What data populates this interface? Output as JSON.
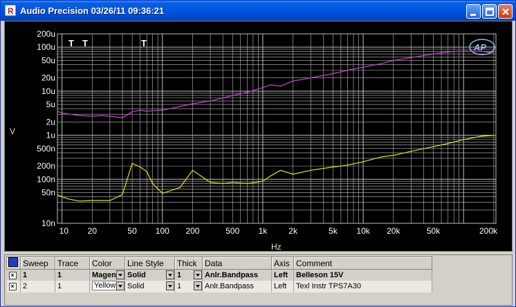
{
  "window": {
    "title": "Audio Precision  03/26/11 09:36:21",
    "app_icon": "R"
  },
  "colors": {
    "trace1": "#d040e0",
    "trace2": "#e8e800",
    "grid": "#c0c0c0",
    "titlebar": "#0054e3"
  },
  "plot": {
    "logo": "AP",
    "ylabel": "V",
    "xlabel": "Hz",
    "markers": [
      "T",
      "T",
      "T"
    ],
    "y_ticks": [
      "200u",
      "100u",
      "50u",
      "20u",
      "10u",
      "5u",
      "2u",
      "1u",
      "500n",
      "200n",
      "100n",
      "50n",
      "10n"
    ],
    "x_ticks": [
      "10",
      "20",
      "50",
      "100",
      "200",
      "500",
      "1k",
      "2k",
      "5k",
      "10k",
      "20k",
      "50k",
      "200k"
    ]
  },
  "chart_data": {
    "type": "line",
    "x_scale": "log",
    "y_scale": "log",
    "xlim": [
      9,
      210000
    ],
    "ylim": [
      1e-08,
      0.0002
    ],
    "xlabel": "Hz",
    "ylabel": "V",
    "series": [
      {
        "color": "#d040e0",
        "x": [
          9,
          10,
          12,
          15,
          20,
          25,
          30,
          40,
          50,
          60,
          70,
          80,
          100,
          150,
          200,
          300,
          400,
          500,
          700,
          1000,
          1200,
          1500,
          2000,
          3000,
          5000,
          7000,
          10000,
          15000,
          20000,
          30000,
          50000,
          70000,
          100000,
          150000,
          200000
        ],
        "y": [
          3.5e-06,
          3.2e-06,
          3e-06,
          2.8e-06,
          2.7e-06,
          2.8e-06,
          2.7e-06,
          2.5e-06,
          3.4e-06,
          3.7e-06,
          3.5e-06,
          3.6e-06,
          3.7e-06,
          4.5e-06,
          5.2e-06,
          6e-06,
          7e-06,
          8e-06,
          9.5e-06,
          1.2e-05,
          1.4e-05,
          1.3e-05,
          1.7e-05,
          2e-05,
          2.5e-05,
          3e-05,
          3.5e-05,
          4.2e-05,
          5e-05,
          5.8e-05,
          7e-05,
          7.8e-05,
          8.2e-05,
          8e-05,
          7.5e-05
        ]
      },
      {
        "color": "#e8e800",
        "x": [
          9,
          10,
          12,
          15,
          20,
          25,
          30,
          40,
          50,
          60,
          70,
          80,
          100,
          150,
          200,
          300,
          400,
          500,
          700,
          1000,
          1200,
          1500,
          2000,
          3000,
          5000,
          7000,
          10000,
          15000,
          20000,
          30000,
          50000,
          70000,
          100000,
          150000,
          200000
        ],
        "y": [
          4.5e-08,
          4e-08,
          3.5e-08,
          3.2e-08,
          3.3e-08,
          3.3e-08,
          3.3e-08,
          4.5e-08,
          2.3e-07,
          1.9e-07,
          1.5e-07,
          8e-08,
          4.8e-08,
          6.5e-08,
          1.6e-07,
          8.5e-08,
          8e-08,
          8.5e-08,
          8e-08,
          9e-08,
          1.2e-07,
          1.6e-07,
          1.3e-07,
          1.6e-07,
          1.9e-07,
          2.1e-07,
          2.5e-07,
          3.2e-07,
          3.5e-07,
          4.3e-07,
          5.5e-07,
          6.5e-07,
          8e-07,
          9.5e-07,
          1e-06
        ]
      }
    ]
  },
  "table": {
    "headers": [
      "Sweep",
      "Trace",
      "Color",
      "Line Style",
      "Thick",
      "Data",
      "Axis",
      "Comment"
    ],
    "rows": [
      {
        "enabled": "×",
        "sweep": "1",
        "trace": "1",
        "color": "Magen",
        "style": "Solid",
        "thick": "1",
        "data": "Anlr.Bandpass",
        "axis": "Left",
        "comment": "Belleson 15V"
      },
      {
        "enabled": "×",
        "sweep": "2",
        "trace": "1",
        "color": "Yellow",
        "style": "Solid",
        "thick": "1",
        "data": "Anlr.Bandpass",
        "axis": "Left",
        "comment": "Texl Instr TPS7A30"
      }
    ]
  }
}
